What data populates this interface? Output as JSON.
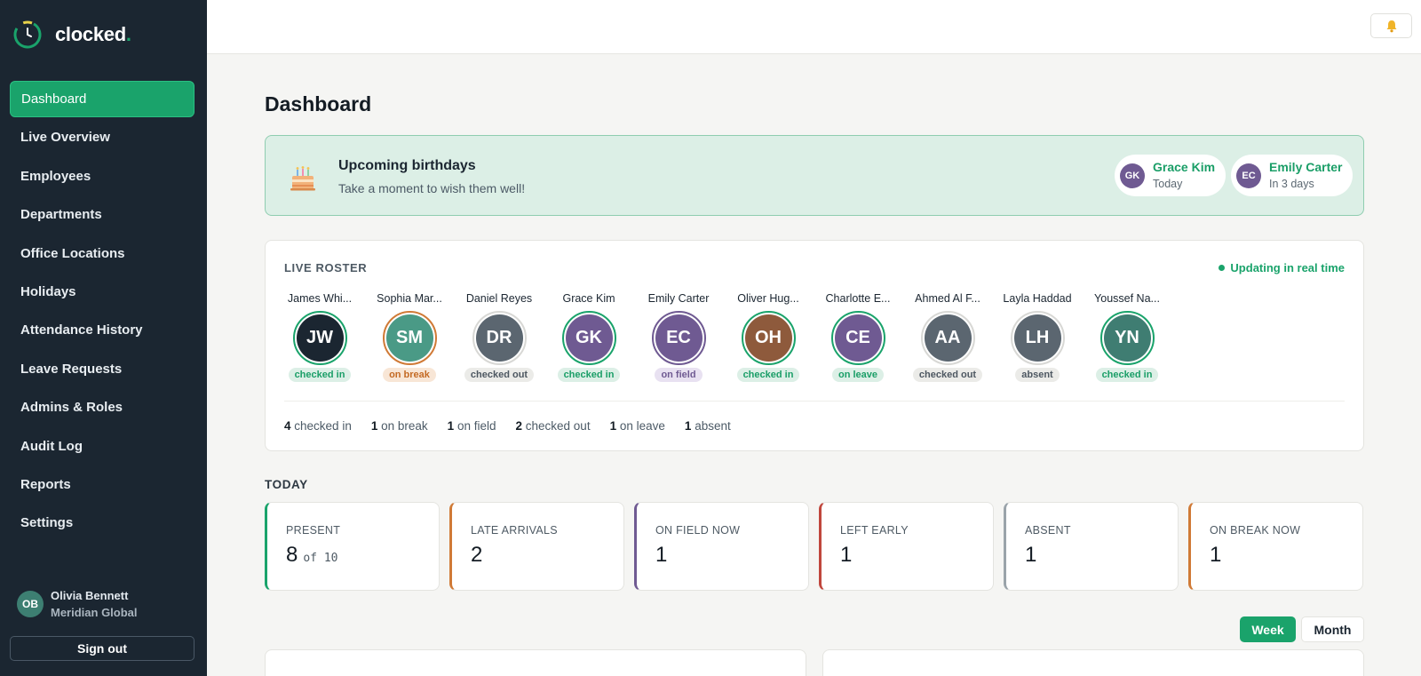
{
  "app": {
    "name": "clocked",
    "name_dot": "."
  },
  "sidebar": {
    "items": [
      {
        "label": "Dashboard",
        "active": true
      },
      {
        "label": "Live Overview"
      },
      {
        "label": "Employees"
      },
      {
        "label": "Departments"
      },
      {
        "label": "Office Locations"
      },
      {
        "label": "Holidays"
      },
      {
        "label": "Attendance History"
      },
      {
        "label": "Leave Requests"
      },
      {
        "label": "Admins & Roles"
      },
      {
        "label": "Audit Log"
      },
      {
        "label": "Reports"
      },
      {
        "label": "Settings"
      }
    ],
    "user": {
      "initials": "OB",
      "name": "Olivia Bennett",
      "org": "Meridian Global"
    },
    "signout_label": "Sign out"
  },
  "topbar": {
    "bell_icon": "bell-icon"
  },
  "page": {
    "title": "Dashboard"
  },
  "birthdays": {
    "title": "Upcoming birthdays",
    "subtitle": "Take a moment to wish them well!",
    "people": [
      {
        "initials": "GK",
        "name": "Grace Kim",
        "when": "Today"
      },
      {
        "initials": "EC",
        "name": "Emily Carter",
        "when": "In 3 days"
      }
    ]
  },
  "roster": {
    "label": "LIVE ROSTER",
    "realtime": "Updating in real time",
    "people": [
      {
        "name": "James Whi...",
        "initials": "JW",
        "status": "checked in",
        "kind": "in",
        "color": "#1b2631",
        "ring": "#1aa36b"
      },
      {
        "name": "Sophia Mar...",
        "initials": "SM",
        "status": "on break",
        "kind": "break",
        "color": "#4a9a86",
        "ring": "#d07a36"
      },
      {
        "name": "Daniel Reyes",
        "initials": "DR",
        "status": "checked out",
        "kind": "out",
        "color": "#5b6670",
        "ring": "#d8d8d5"
      },
      {
        "name": "Grace Kim",
        "initials": "GK",
        "status": "checked in",
        "kind": "in",
        "color": "#6f5a92",
        "ring": "#1aa36b"
      },
      {
        "name": "Emily Carter",
        "initials": "EC",
        "status": "on field",
        "kind": "field",
        "color": "#6f5a92",
        "ring": "#6f5a92"
      },
      {
        "name": "Oliver Hug...",
        "initials": "OH",
        "status": "checked in",
        "kind": "in",
        "color": "#8e5a3c",
        "ring": "#1aa36b"
      },
      {
        "name": "Charlotte E...",
        "initials": "CE",
        "status": "on leave",
        "kind": "leave",
        "color": "#6f5a92",
        "ring": "#1aa36b"
      },
      {
        "name": "Ahmed Al F...",
        "initials": "AA",
        "status": "checked out",
        "kind": "out",
        "color": "#5b6670",
        "ring": "#d8d8d5"
      },
      {
        "name": "Layla Haddad",
        "initials": "LH",
        "status": "absent",
        "kind": "absent",
        "color": "#5b6670",
        "ring": "#d8d8d5"
      },
      {
        "name": "Youssef Na...",
        "initials": "YN",
        "status": "checked in",
        "kind": "in",
        "color": "#3f7d72",
        "ring": "#1aa36b"
      }
    ],
    "summary": [
      {
        "count": "4",
        "label": "checked in"
      },
      {
        "count": "1",
        "label": "on break"
      },
      {
        "count": "1",
        "label": "on field"
      },
      {
        "count": "2",
        "label": "checked out"
      },
      {
        "count": "1",
        "label": "on leave"
      },
      {
        "count": "1",
        "label": "absent"
      }
    ]
  },
  "today": {
    "label": "TODAY",
    "stats": [
      {
        "label": "PRESENT",
        "value": "8",
        "of": "of 10",
        "accent": "#1aa36b"
      },
      {
        "label": "LATE ARRIVALS",
        "value": "2",
        "accent": "#d07a36"
      },
      {
        "label": "ON FIELD NOW",
        "value": "1",
        "accent": "#6f5a92"
      },
      {
        "label": "LEFT EARLY",
        "value": "1",
        "accent": "#c0463c"
      },
      {
        "label": "ABSENT",
        "value": "1",
        "accent": "#9aa3aa"
      },
      {
        "label": "ON BREAK NOW",
        "value": "1",
        "accent": "#d07a36"
      }
    ]
  },
  "range": {
    "week": "Week",
    "month": "Month"
  },
  "colors": {
    "accent": "#1aa36b",
    "sidebar_bg": "#1b2631"
  }
}
